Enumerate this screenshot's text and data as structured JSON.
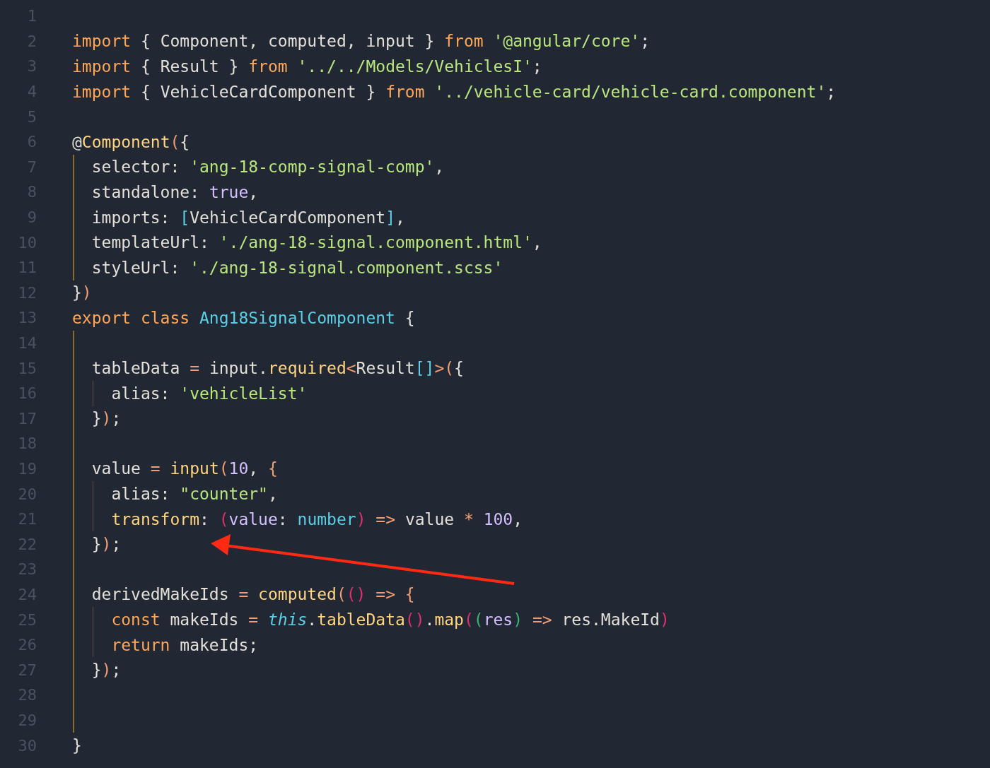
{
  "editor": {
    "lines": [
      {
        "number": "1"
      },
      {
        "number": "2",
        "tokens": [
          {
            "kind": "kw",
            "text": "import"
          },
          {
            "kind": "plain",
            "text": " { Component, computed, input } "
          },
          {
            "kind": "kw",
            "text": "from"
          },
          {
            "kind": "str",
            "text": " '@angular/core'"
          },
          {
            "kind": "plain",
            "text": ";"
          }
        ]
      },
      {
        "number": "3",
        "tokens": [
          {
            "kind": "kw",
            "text": "import"
          },
          {
            "kind": "plain",
            "text": " { Result } "
          },
          {
            "kind": "kw",
            "text": "from"
          },
          {
            "kind": "str",
            "text": " '../../Models/VehiclesI'"
          },
          {
            "kind": "plain",
            "text": ";"
          }
        ]
      },
      {
        "number": "4",
        "tokens": [
          {
            "kind": "kw",
            "text": "import"
          },
          {
            "kind": "plain",
            "text": " { VehicleCardComponent } "
          },
          {
            "kind": "kw",
            "text": "from"
          },
          {
            "kind": "str",
            "text": " '../vehicle-card/vehicle-card.component'"
          },
          {
            "kind": "plain",
            "text": ";"
          }
        ]
      },
      {
        "number": "5"
      },
      {
        "number": "6",
        "tokens": [
          {
            "kind": "plain",
            "text": "@"
          },
          {
            "kind": "fn",
            "text": "Component"
          },
          {
            "kind": "op",
            "text": "("
          },
          {
            "kind": "plain",
            "text": "{"
          }
        ]
      },
      {
        "number": "7",
        "tokens": [
          {
            "kind": "plain",
            "text": "  selector: "
          },
          {
            "kind": "str",
            "text": "'ang-18-comp-signal-comp'"
          },
          {
            "kind": "plain",
            "text": ","
          }
        ]
      },
      {
        "number": "8",
        "tokens": [
          {
            "kind": "plain",
            "text": "  standalone: "
          },
          {
            "kind": "num",
            "text": "true"
          },
          {
            "kind": "plain",
            "text": ","
          }
        ]
      },
      {
        "number": "9",
        "tokens": [
          {
            "kind": "plain",
            "text": "  imports: "
          },
          {
            "kind": "type",
            "text": "["
          },
          {
            "kind": "plain",
            "text": "VehicleCardComponent"
          },
          {
            "kind": "type",
            "text": "]"
          },
          {
            "kind": "plain",
            "text": ","
          }
        ]
      },
      {
        "number": "10",
        "tokens": [
          {
            "kind": "plain",
            "text": "  templateUrl: "
          },
          {
            "kind": "str",
            "text": "'./ang-18-signal.component.html'"
          },
          {
            "kind": "plain",
            "text": ","
          }
        ]
      },
      {
        "number": "11",
        "tokens": [
          {
            "kind": "plain",
            "text": "  styleUrl: "
          },
          {
            "kind": "str",
            "text": "'./ang-18-signal.component.scss'"
          }
        ]
      },
      {
        "number": "12",
        "tokens": [
          {
            "kind": "plain",
            "text": "}"
          },
          {
            "kind": "op",
            "text": ")"
          }
        ]
      },
      {
        "number": "13",
        "tokens": [
          {
            "kind": "kw",
            "text": "export class"
          },
          {
            "kind": "type",
            "text": " Ang18SignalComponent"
          },
          {
            "kind": "plain",
            "text": " {"
          }
        ]
      },
      {
        "number": "14"
      },
      {
        "number": "15",
        "tokens": [
          {
            "kind": "plain",
            "text": "  tableData "
          },
          {
            "kind": "op",
            "text": "="
          },
          {
            "kind": "plain",
            "text": " input."
          },
          {
            "kind": "fn",
            "text": "required"
          },
          {
            "kind": "op",
            "text": "<"
          },
          {
            "kind": "plain",
            "text": "Result"
          },
          {
            "kind": "type",
            "text": "[]"
          },
          {
            "kind": "op",
            "text": ">("
          },
          {
            "kind": "plain",
            "text": "{"
          }
        ]
      },
      {
        "number": "16",
        "tokens": [
          {
            "kind": "plain",
            "text": "    alias: "
          },
          {
            "kind": "str",
            "text": "'vehicleList'"
          }
        ]
      },
      {
        "number": "17",
        "tokens": [
          {
            "kind": "plain",
            "text": "  }"
          },
          {
            "kind": "op",
            "text": ")"
          },
          {
            "kind": "plain",
            "text": ";"
          }
        ]
      },
      {
        "number": "18"
      },
      {
        "number": "19",
        "tokens": [
          {
            "kind": "plain",
            "text": "  value "
          },
          {
            "kind": "op",
            "text": "="
          },
          {
            "kind": "fn",
            "text": " input"
          },
          {
            "kind": "op",
            "text": "("
          },
          {
            "kind": "num",
            "text": "10"
          },
          {
            "kind": "plain",
            "text": ","
          },
          {
            "kind": "op",
            "text": " {"
          }
        ]
      },
      {
        "number": "20",
        "tokens": [
          {
            "kind": "plain",
            "text": "    alias: "
          },
          {
            "kind": "str",
            "text": "\"counter\""
          },
          {
            "kind": "plain",
            "text": ","
          }
        ]
      },
      {
        "number": "21",
        "tokens": [
          {
            "kind": "fn",
            "text": "    transform"
          },
          {
            "kind": "plain",
            "text": ": "
          },
          {
            "kind": "paren",
            "text": "("
          },
          {
            "kind": "num",
            "text": "value"
          },
          {
            "kind": "plain",
            "text": ": "
          },
          {
            "kind": "type",
            "text": "number"
          },
          {
            "kind": "paren",
            "text": ")"
          },
          {
            "kind": "op",
            "text": " =>"
          },
          {
            "kind": "plain",
            "text": " value "
          },
          {
            "kind": "op",
            "text": "*"
          },
          {
            "kind": "num",
            "text": " 100"
          },
          {
            "kind": "plain",
            "text": ","
          }
        ]
      },
      {
        "number": "22",
        "tokens": [
          {
            "kind": "plain",
            "text": "  }"
          },
          {
            "kind": "op",
            "text": ")"
          },
          {
            "kind": "plain",
            "text": ";"
          }
        ]
      },
      {
        "number": "23"
      },
      {
        "number": "24",
        "tokens": [
          {
            "kind": "plain",
            "text": "  derivedMakeIds "
          },
          {
            "kind": "op",
            "text": "="
          },
          {
            "kind": "fn",
            "text": " computed"
          },
          {
            "kind": "op",
            "text": "("
          },
          {
            "kind": "paren",
            "text": "()"
          },
          {
            "kind": "op",
            "text": " =>"
          },
          {
            "kind": "op",
            "text": " {"
          }
        ]
      },
      {
        "number": "25",
        "tokens": [
          {
            "kind": "kw",
            "text": "    const"
          },
          {
            "kind": "plain",
            "text": " makeIds "
          },
          {
            "kind": "op",
            "text": "="
          },
          {
            "kind": "this",
            "text": " this"
          },
          {
            "kind": "plain",
            "text": "."
          },
          {
            "kind": "fn",
            "text": "tableData"
          },
          {
            "kind": "paren",
            "text": "()"
          },
          {
            "kind": "plain",
            "text": "."
          },
          {
            "kind": "fn",
            "text": "map"
          },
          {
            "kind": "paren",
            "text": "("
          },
          {
            "kind": "paren2",
            "text": "("
          },
          {
            "kind": "num",
            "text": "res"
          },
          {
            "kind": "paren2",
            "text": ")"
          },
          {
            "kind": "op",
            "text": " =>"
          },
          {
            "kind": "plain",
            "text": " res.MakeId"
          },
          {
            "kind": "paren",
            "text": ")"
          }
        ]
      },
      {
        "number": "26",
        "tokens": [
          {
            "kind": "kw",
            "text": "    return"
          },
          {
            "kind": "plain",
            "text": " makeIds;"
          }
        ]
      },
      {
        "number": "27",
        "tokens": [
          {
            "kind": "plain",
            "text": "  }"
          },
          {
            "kind": "op",
            "text": ")"
          },
          {
            "kind": "plain",
            "text": ";"
          }
        ]
      },
      {
        "number": "28"
      },
      {
        "number": "29"
      },
      {
        "number": "30",
        "tokens": [
          {
            "kind": "plain",
            "text": "}"
          }
        ]
      }
    ]
  }
}
